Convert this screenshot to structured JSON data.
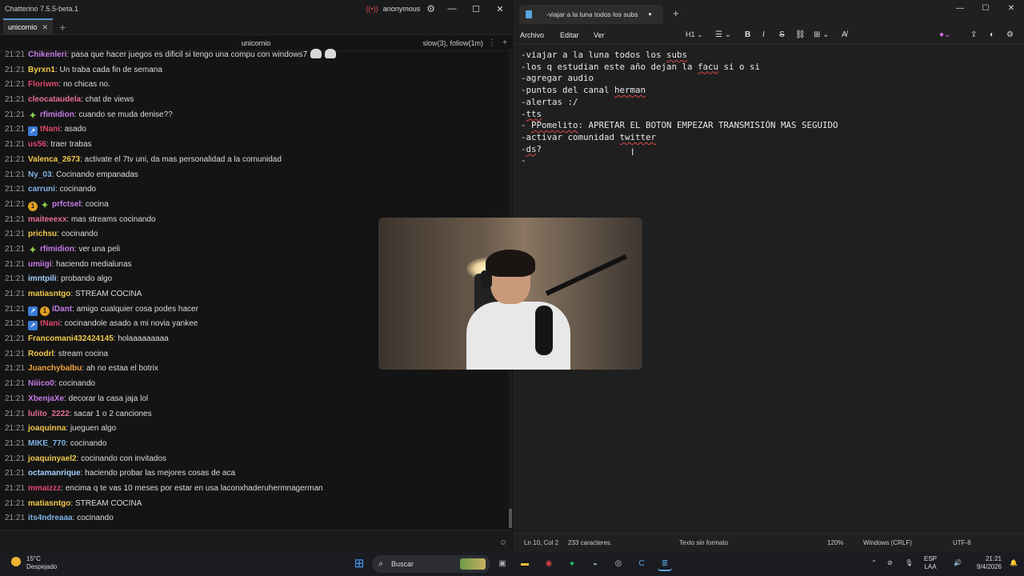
{
  "chat": {
    "window_title": "Chatterino 7.5.5-beta.1",
    "user": "anonymous",
    "tab": "unicornio",
    "channel": "unicornio",
    "mode": "slow(3), follow(1m)",
    "messages": [
      {
        "time": "21:21",
        "user": "Chikenleri",
        "color": "#c77be8",
        "badges": [],
        "text": "pasa que hacer juegos es dificil si tengo una compu con windows7",
        "emotes": 2
      },
      {
        "time": "21:21",
        "user": "Byrxn1",
        "color": "#f2c94c",
        "badges": [],
        "text": "Un traba cada fin de semana"
      },
      {
        "time": "21:21",
        "user": "Floriwm",
        "color": "#e0466c",
        "badges": [],
        "text": "no chicas no."
      },
      {
        "time": "21:21",
        "user": "cleocataudela",
        "color": "#e66d9a",
        "badges": [],
        "text": "chat de views"
      },
      {
        "time": "21:21",
        "user": "rfimidion",
        "color": "#c77be8",
        "badges": [
          "star"
        ],
        "text": "cuando se muda denise??"
      },
      {
        "time": "21:21",
        "user": "tNani",
        "color": "#e0466c",
        "badges": [
          "sub"
        ],
        "text": "asado"
      },
      {
        "time": "21:21",
        "user": "us56",
        "color": "#e0466c",
        "badges": [],
        "text": "traer trabas"
      },
      {
        "time": "21:21",
        "user": "Valenca_2673",
        "color": "#f2c94c",
        "badges": [],
        "text": "activate el 7tv uni, da mas personalidad a la comunidad"
      },
      {
        "time": "21:21",
        "user": "Ny_03",
        "color": "#7fb3e6",
        "badges": [],
        "text": "Cocinando empanadas"
      },
      {
        "time": "21:21",
        "user": "carruni",
        "color": "#7fb3e6",
        "badges": [],
        "text": "cocinando"
      },
      {
        "time": "21:21",
        "user": "prfctsel",
        "color": "#c77be8",
        "badges": [
          "coin",
          "star"
        ],
        "text": "cocina"
      },
      {
        "time": "21:21",
        "user": "maiteeexx",
        "color": "#e66d9a",
        "badges": [],
        "text": "mas streams cocinando"
      },
      {
        "time": "21:21",
        "user": "prichsu",
        "color": "#f2c94c",
        "badges": [],
        "text": "cocinando"
      },
      {
        "time": "21:21",
        "user": "rfimidion",
        "color": "#c77be8",
        "badges": [
          "star"
        ],
        "text": "ver una peli"
      },
      {
        "time": "21:21",
        "user": "umiigi",
        "color": "#c77be8",
        "badges": [],
        "text": "haciendo medialunas"
      },
      {
        "time": "21:21",
        "user": "imntpili",
        "color": "#9fd0ff",
        "badges": [],
        "text": "probando algo"
      },
      {
        "time": "21:21",
        "user": "matiasntgo",
        "color": "#f2c94c",
        "badges": [],
        "text": "STREAM COCINA"
      },
      {
        "time": "21:21",
        "user": "iDant",
        "color": "#c77be8",
        "badges": [
          "sub",
          "coin"
        ],
        "text": "amigo cualquier cosa podes hacer"
      },
      {
        "time": "21:21",
        "user": "tNani",
        "color": "#e0466c",
        "badges": [
          "sub"
        ],
        "text": "cocinandole asado a mi novia yankee"
      },
      {
        "time": "21:21",
        "user": "Francomani432424145",
        "color": "#f2c94c",
        "badges": [],
        "text": "holaaaaaaaaa"
      },
      {
        "time": "21:21",
        "user": "Roodrl",
        "color": "#f2c94c",
        "badges": [],
        "text": "stream cocina"
      },
      {
        "time": "21:21",
        "user": "Juanchybalbu",
        "color": "#f0a040",
        "badges": [],
        "text": "ah no estaa el botrix"
      },
      {
        "time": "21:21",
        "user": "Niiico0",
        "color": "#c77be8",
        "badges": [],
        "text": "cocinando"
      },
      {
        "time": "21:21",
        "user": "XbenjaXe",
        "color": "#c77be8",
        "badges": [],
        "text": "decorar la casa jaja lol"
      },
      {
        "time": "21:21",
        "user": "lulito_2222",
        "color": "#e66d9a",
        "badges": [],
        "text": "sacar 1 o 2 canciones"
      },
      {
        "time": "21:21",
        "user": "joaquinna",
        "color": "#f2c94c",
        "badges": [],
        "text": "jueguen algo"
      },
      {
        "time": "21:21",
        "user": "MIKE_770",
        "color": "#7fb3e6",
        "badges": [],
        "text": "cocinando"
      },
      {
        "time": "21:21",
        "user": "joaquinyael2",
        "color": "#f2c94c",
        "badges": [],
        "text": "cocinando con invitados"
      },
      {
        "time": "21:21",
        "user": "octamanrique",
        "color": "#9fd0ff",
        "badges": [],
        "text": "haciendo probar las mejores cosas de aca"
      },
      {
        "time": "21:21",
        "user": "mmaizzz",
        "color": "#e0466c",
        "badges": [],
        "text": "encima q te vas 10 meses por estar en usa laconxhaderuhermnagerman"
      },
      {
        "time": "21:21",
        "user": "matiasntgo",
        "color": "#f2c94c",
        "badges": [],
        "text": "STREAM COCINA"
      },
      {
        "time": "21:21",
        "user": "its4ndreaaa",
        "color": "#7fb3e6",
        "badges": [],
        "text": "cocinando"
      }
    ]
  },
  "notepad": {
    "tab_title": "-viajar a la luna todos los subs",
    "tab_modified": "●",
    "menu": {
      "archivo": "Archivo",
      "editar": "Editar",
      "ver": "Ver"
    },
    "heading": "H1",
    "lines": [
      [
        {
          "t": "-viajar a la luna todos los "
        },
        {
          "t": "subs",
          "sq": true
        }
      ],
      [
        {
          "t": "-los q estudian este año dejan la "
        },
        {
          "t": "facu",
          "sq": true
        },
        {
          "t": " si o si"
        }
      ],
      [
        {
          "t": "-agregar audio"
        }
      ],
      [
        {
          "t": "-puntos del canal "
        },
        {
          "t": "herman",
          "sq": true
        }
      ],
      [
        {
          "t": "-alertas :/"
        }
      ],
      [
        {
          "t": "-"
        },
        {
          "t": "tts",
          "sq": true
        }
      ],
      [
        {
          "t": "- "
        },
        {
          "t": "PPomelito",
          "sq": true
        },
        {
          "t": ": APRETAR EL BOTON EMPEZAR TRANSMISIÓN MAS SEGUIDO"
        }
      ],
      [
        {
          "t": "-activar comunidad "
        },
        {
          "t": "twitter",
          "sq": true
        }
      ],
      [
        {
          "t": "-"
        },
        {
          "t": "ds",
          "sq": true
        },
        {
          "t": "?"
        }
      ],
      [
        {
          "t": "-"
        }
      ]
    ],
    "status": {
      "position": "Ln 10, Col 2",
      "chars": "233 caracteres.",
      "format": "Texto sin formato",
      "zoom": "120%",
      "eol": "Windows (CRLF)",
      "encoding": "UTF-8"
    }
  },
  "taskbar": {
    "weather_temp": "15°C",
    "weather_desc": "Despejado",
    "search": "Buscar",
    "lang1": "ESP",
    "lang2": "LAA",
    "time": "21:21",
    "date": "9/4/2026"
  }
}
